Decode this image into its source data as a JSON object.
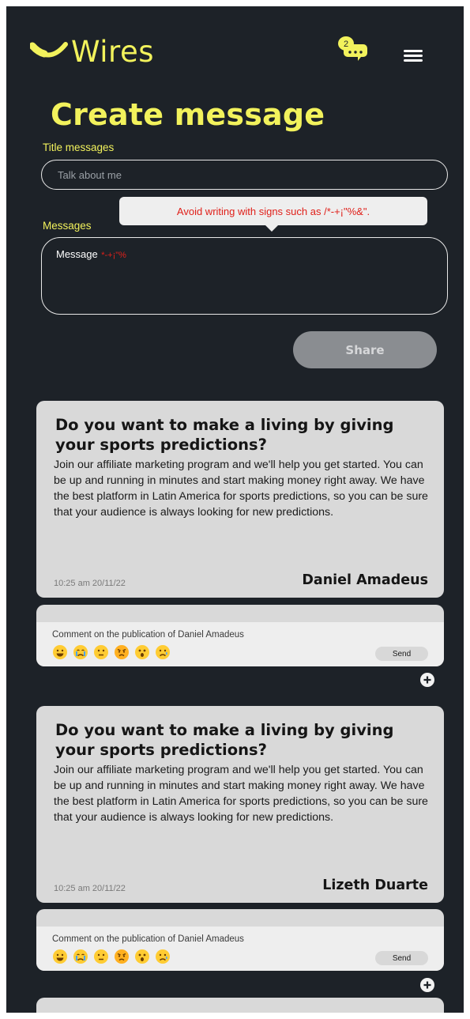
{
  "header": {
    "brand": "Wires",
    "notification_count": "2",
    "chat_icon": "chat-bubble-icon",
    "menu_icon": "hamburger-menu-icon"
  },
  "form": {
    "page_title": "Create message",
    "title_label": "Title messages",
    "title_placeholder": "Talk about me",
    "messages_label": "Messages",
    "tooltip": "Avoid writing with signs such as /*-+¡\"%&\".",
    "message_value": "Message",
    "message_signs": "*-+¡\"%",
    "share_label": "Share"
  },
  "posts": [
    {
      "title": "Do you want to make a living by giving your sports predictions?",
      "body": "Join our affiliate marketing program and we'll help you get started. You can be up and running in minutes and start making money right away. We have the best platform in Latin America for sports predictions, so you can be sure that your audience is always looking for new predictions.",
      "time": "10:25 am 20/11/22",
      "author": "Daniel Amadeus",
      "comment_label": "Comment on the publication of Daniel Amadeus",
      "send_label": "Send"
    },
    {
      "title": "Do you want to make a living by giving your sports predictions?",
      "body": "Join our affiliate marketing program and we'll help you get started. You can be up and running in minutes and start making money right away. We have the best platform in Latin America for sports predictions, so you can be sure that your audience is always looking for new predictions.",
      "time": "10:25 am 20/11/22",
      "author": "Lizeth Duarte",
      "comment_label": "Comment on the publication of Daniel Amadeus",
      "send_label": "Send"
    }
  ],
  "emoji_reactions": [
    "grin-emoji",
    "crying-emoji",
    "neutral-emoji",
    "angry-emoji",
    "surprised-emoji",
    "sad-emoji"
  ],
  "colors": {
    "background": "#1d2228",
    "accent": "#f2f25c",
    "card": "#d9d9d9",
    "warning": "#e0201a",
    "share_button": "#8a8d91"
  }
}
